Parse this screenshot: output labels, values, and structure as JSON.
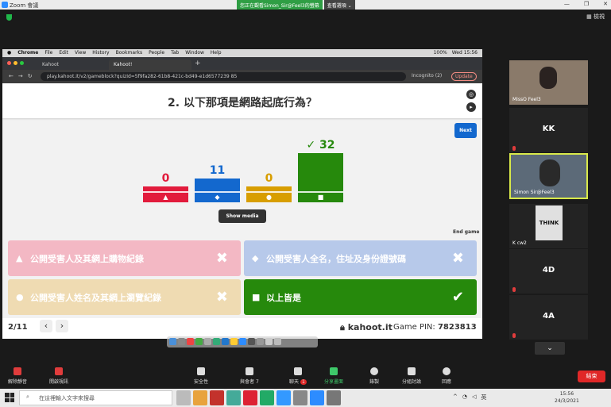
{
  "zoom": {
    "title": "Zoom 會議",
    "banner_sharing": "您正在觀看Simon_Sir@Feel3的螢幕",
    "banner_view": "查看選項 ⌄",
    "view_btn": "檢視"
  },
  "mac_menu": {
    "items": [
      "Chrome",
      "File",
      "Edit",
      "View",
      "History",
      "Bookmarks",
      "People",
      "Tab",
      "Window",
      "Help"
    ],
    "battery": "100%",
    "datetime": "Wed 15:56"
  },
  "browser": {
    "tabs": [
      "Kahoot",
      "Kahoot!"
    ],
    "url": "play.kahoot.it/v2/gameblock?quizId=5f9fa282-61b8-421c-bd49-e1d6577239 85",
    "incognito": "Incognito (2)",
    "update": "Update"
  },
  "kahoot": {
    "question": "2. 以下那項是網路起底行為？",
    "next": "Next",
    "show_media": "Show media",
    "end_game": "End game",
    "check": "✓",
    "answers": [
      {
        "text": "公開受害人及其網上購物紀錄",
        "symbol": "▲",
        "color": "#f3b8c4",
        "correct": false
      },
      {
        "text": "公開受害人全名，住址及身份證號碼",
        "symbol": "◆",
        "color": "#b7c9ea",
        "correct": false
      },
      {
        "text": "公開受害人姓名及其網上瀏覽紀錄",
        "symbol": "●",
        "color": "#efdbb2",
        "correct": false
      },
      {
        "text": "以上皆是",
        "symbol": "■",
        "color": "#26890c",
        "correct": true
      }
    ],
    "result_wrong": "✖",
    "result_right": "✔",
    "progress": "2/11",
    "nav_prev": "‹",
    "nav_next": "›",
    "site": "kahoot.it",
    "pin_label": "Game PIN:",
    "pin": "7823813",
    "chart_data": {
      "type": "bar",
      "categories": [
        "▲",
        "◆",
        "●",
        "■"
      ],
      "values": [
        0,
        11,
        0,
        32
      ],
      "colors": [
        "#e21b3c",
        "#1368ce",
        "#d89e00",
        "#26890c"
      ],
      "correct_index": 3
    }
  },
  "participants": [
    {
      "name": "MissO Feel3",
      "kind": "video"
    },
    {
      "name": "KK",
      "kind": "text"
    },
    {
      "name": "Simon Sir@Feel3",
      "kind": "video-active"
    },
    {
      "name": "K cw2",
      "kind": "image",
      "image_text": "THINK"
    },
    {
      "name": "4D",
      "kind": "text"
    },
    {
      "name": "4A",
      "kind": "text"
    }
  ],
  "toolbar": {
    "mute": "解除靜音",
    "video": "開啟視訊",
    "security": "安全性",
    "participants": "與會者",
    "participants_count": "7",
    "chat": "聊天",
    "chat_badge": "1",
    "share": "分享畫面",
    "record": "錄製",
    "breakout": "分組討論",
    "reactions": "回應",
    "end": "結束"
  },
  "taskbar": {
    "search": "在這裡輸入文字來搜尋",
    "time": "15:56",
    "date": "24/3/2021",
    "lang": "英"
  }
}
